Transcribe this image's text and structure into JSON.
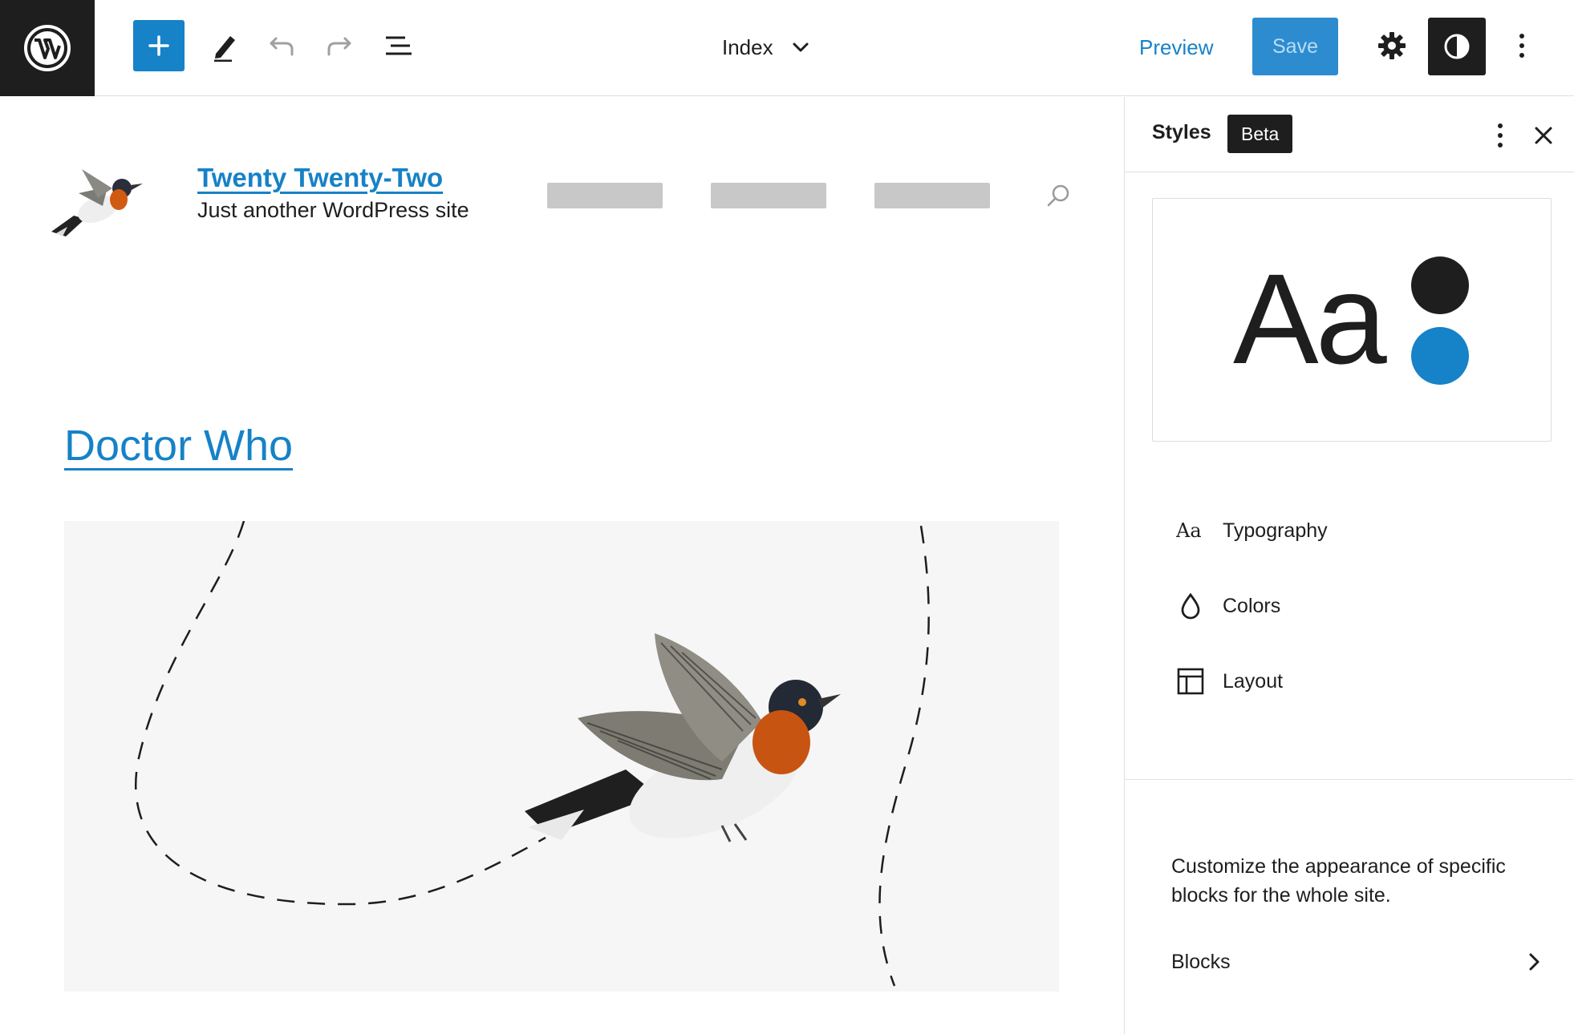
{
  "toolbar": {
    "logo_icon": "wordpress-logo",
    "add_block_icon": "plus-icon",
    "tools_icon": "pencil-icon",
    "undo_icon": "undo-icon",
    "redo_icon": "redo-icon",
    "list_view_icon": "list-view-icon",
    "document_title": "Index",
    "document_dropdown_icon": "chevron-down-icon",
    "preview_label": "Preview",
    "save_label": "Save",
    "settings_icon": "gear-icon",
    "styles_icon": "half-circle-contrast-icon",
    "more_icon": "vertical-ellipsis-icon"
  },
  "canvas": {
    "site_title": "Twenty Twenty-Two",
    "site_tagline": "Just another WordPress site",
    "nav_item_count_placeholder_color": "#c8c8c8",
    "search_icon": "search-icon",
    "post_title": "Doctor Who",
    "featured_image": "flying-bird-illustration"
  },
  "sidebar": {
    "title": "Styles",
    "badge": "Beta",
    "more_icon": "vertical-ellipsis-icon",
    "close_icon": "close-icon",
    "preview": {
      "sample_text": "Aa",
      "swatches": [
        "#1e1e1e",
        "#1682c7"
      ]
    },
    "menu": [
      {
        "label": "Typography",
        "icon": "typography-icon"
      },
      {
        "label": "Colors",
        "icon": "droplet-icon"
      },
      {
        "label": "Layout",
        "icon": "layout-icon"
      }
    ],
    "description": "Customize the appearance of specific blocks for the whole site.",
    "blocks_label": "Blocks",
    "blocks_icon": "chevron-right-icon"
  },
  "colors": {
    "accent": "#1682c7",
    "dark": "#1e1e1e",
    "border": "#e0e0e0"
  }
}
